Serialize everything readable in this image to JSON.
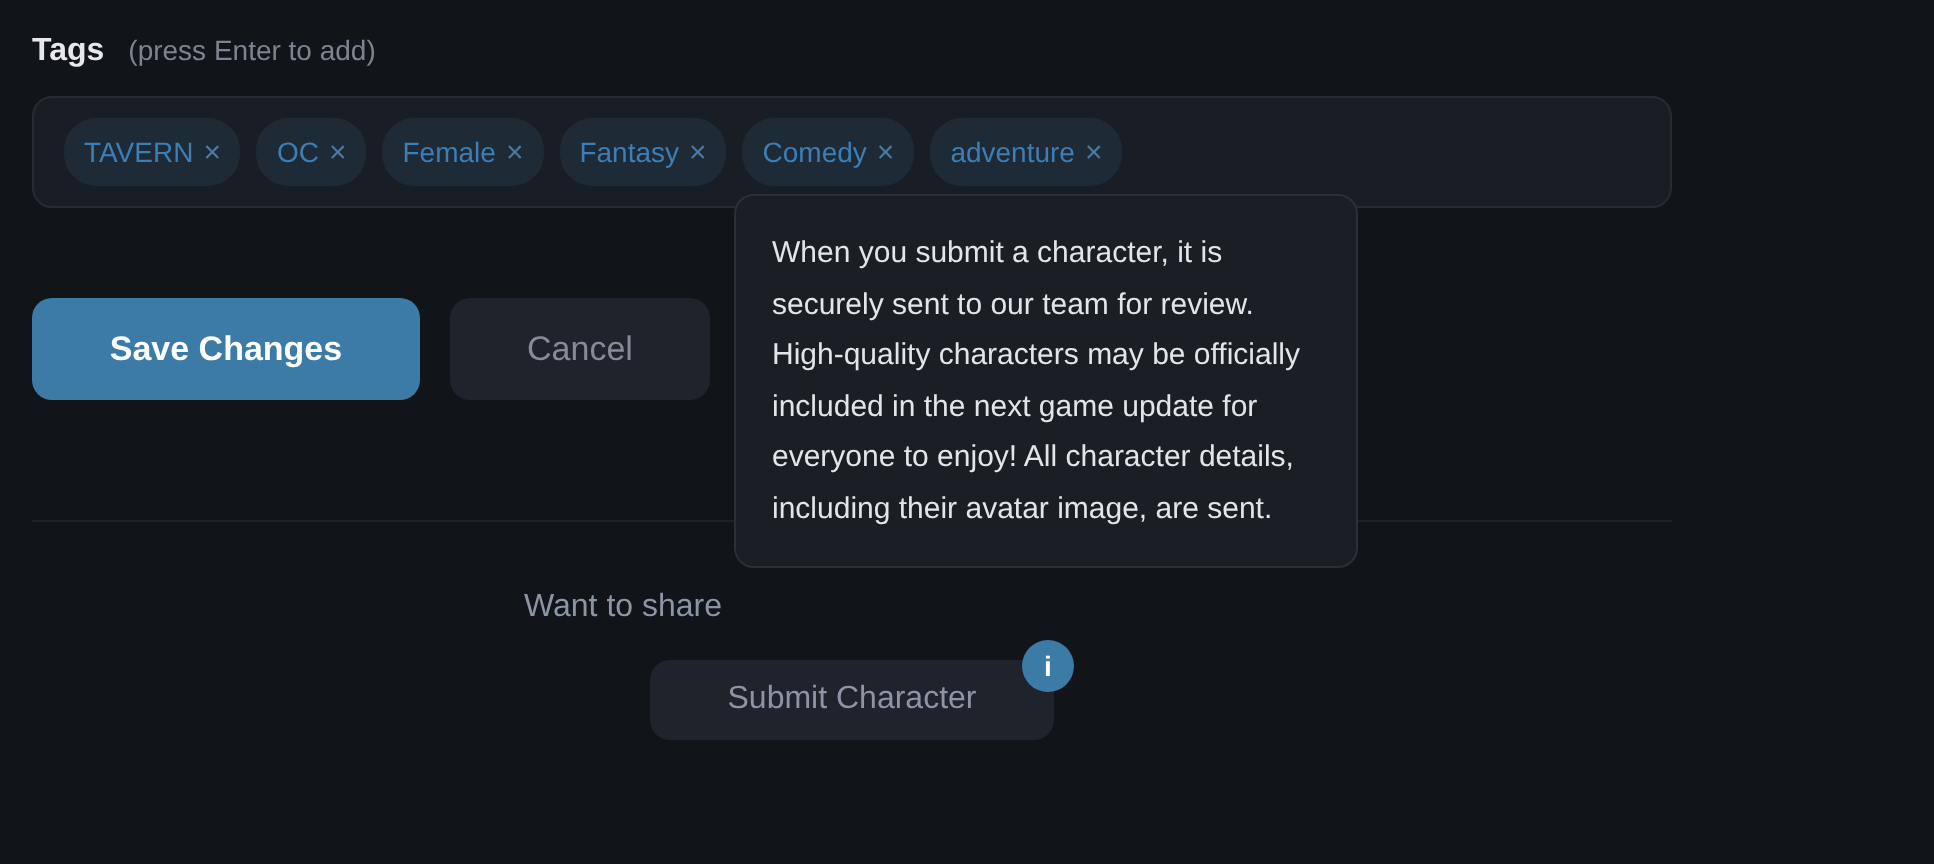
{
  "tags_field": {
    "label": "Tags",
    "hint": "(press Enter to add)",
    "tags": [
      {
        "text": "TAVERN",
        "remove": "×"
      },
      {
        "text": "OC",
        "remove": "×"
      },
      {
        "text": "Female",
        "remove": "×"
      },
      {
        "text": "Fantasy",
        "remove": "×"
      },
      {
        "text": "Comedy",
        "remove": "×"
      },
      {
        "text": "adventure",
        "remove": "×"
      }
    ]
  },
  "buttons": [
    {
      "label": "Save Changes",
      "kind": "primary"
    },
    {
      "label": "Cancel",
      "kind": "secondary"
    }
  ],
  "submit_section": {
    "prompt": "Want to share",
    "button": "Submit Character",
    "info_badge": "i",
    "tooltip": "When you submit a character, it is securely sent to our team for review. High-quality characters may be officially included in the next game update for everyone to enjoy! All character details, including their avatar image, are sent."
  }
}
